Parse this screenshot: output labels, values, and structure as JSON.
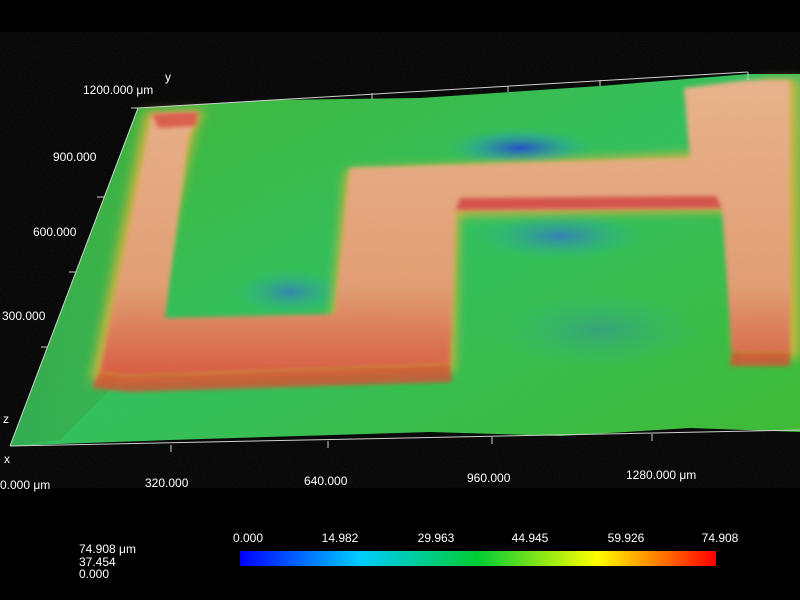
{
  "scale_colors": [
    "#0000ff",
    "#00ccff",
    "#00cc33",
    "#ffff00",
    "#ff0000"
  ],
  "surface_colors": {
    "low": "#1a2fd6",
    "mid_low": "#23c06a",
    "mid": "#3ec035",
    "high": "#e7a87a",
    "edge": "#d8463a"
  },
  "axes": {
    "y_label": "y",
    "x_label": "x",
    "z_label": "z",
    "y_ticks": [
      "1200.000 μm",
      "900.000",
      "600.000",
      "300.000"
    ],
    "x_ticks": [
      "0.000 μm",
      "320.000",
      "640.000",
      "960.000",
      "1280.000 μm"
    ]
  },
  "z_legend": {
    "max": "74.908 μm",
    "mid": "37.454",
    "min": "0.000"
  },
  "color_scale": {
    "ticks": [
      "0.000",
      "14.982",
      "29.963",
      "44.945",
      "59.926",
      "74.908"
    ]
  }
}
